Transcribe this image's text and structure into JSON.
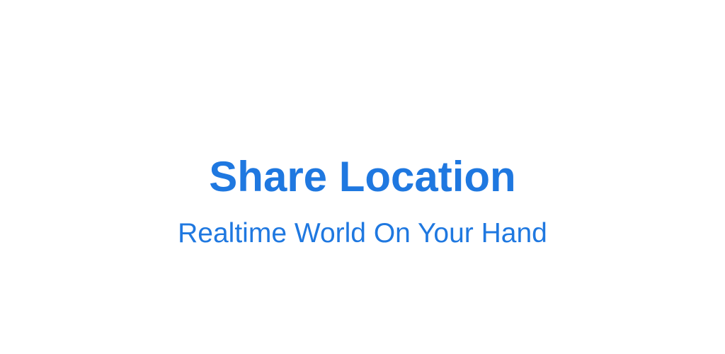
{
  "banner": {
    "title": "Share Location",
    "subtitle": "Realtime World On Your Hand",
    "text_color": "#1f78e0",
    "background_color": "#ffffff"
  }
}
